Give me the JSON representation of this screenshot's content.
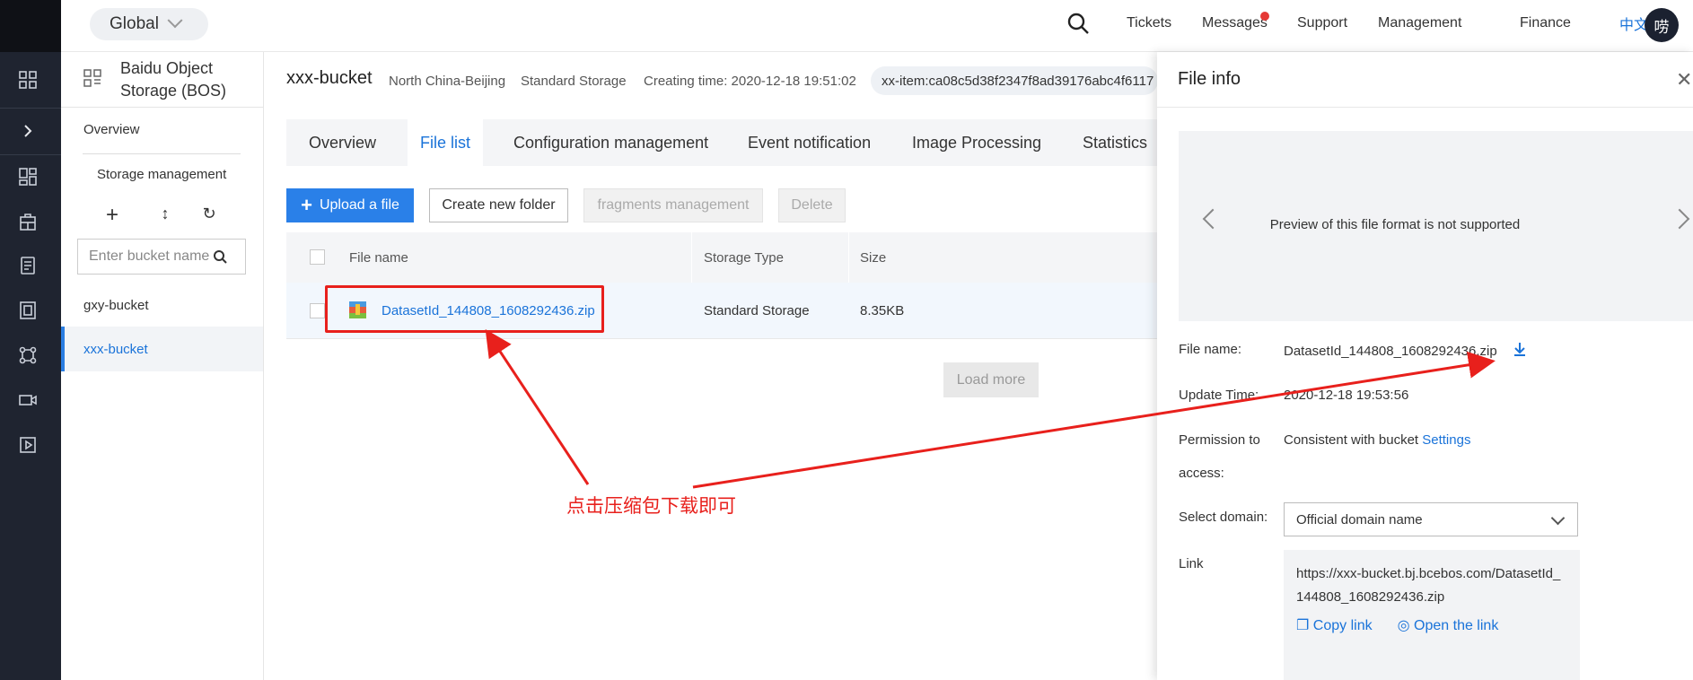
{
  "topbar": {
    "region": "Global",
    "nav": [
      "Tickets",
      "Messages",
      "Support",
      "Management",
      "Finance",
      "中文"
    ],
    "avatar": "唠"
  },
  "sidebar": {
    "service_title_line1": "Baidu Object",
    "service_title_line2": "Storage (BOS)",
    "overview": "Overview",
    "storage_management": "Storage management",
    "search_placeholder": "Enter bucket name",
    "buckets": [
      "gxy-bucket",
      "xxx-bucket"
    ],
    "active_bucket": "xxx-bucket"
  },
  "main": {
    "bucket_name": "xxx-bucket",
    "region": "North China-Beijing",
    "storage_class": "Standard Storage",
    "creating_time": "Creating time: 2020-12-18 19:51:02",
    "item_id": "xx-item:ca08c5d38f2347f8ad39176abc4f6117",
    "tabs": [
      "Overview",
      "File list",
      "Configuration management",
      "Event notification",
      "Image Processing",
      "Statistics"
    ],
    "active_tab": "File list",
    "buttons": {
      "upload": "Upload a file",
      "new_folder": "Create new folder",
      "fragments": "fragments management",
      "delete": "Delete"
    },
    "table": {
      "headers": [
        "File name",
        "Storage Type",
        "Size"
      ],
      "rows": [
        {
          "file_name": "DatasetId_144808_1608292436.zip",
          "storage_type": "Standard Storage",
          "size": "8.35KB"
        }
      ]
    },
    "load_more": "Load more",
    "annotation": "点击压缩包下载即可"
  },
  "drawer": {
    "title": "File info",
    "preview_text": "Preview of this file format is not supported",
    "file_name_label": "File name:",
    "file_name": "DatasetId_144808_1608292436.zip",
    "update_time_label": "Update Time:",
    "update_time": "2020-12-18 19:53:56",
    "permission_label_1": "Permission to",
    "permission_label_2": "access:",
    "permission_value": "Consistent with bucket",
    "settings_link": "Settings",
    "domain_label": "Select domain:",
    "domain_value": "Official domain name",
    "link_label": "Link",
    "link_line1": "https://xxx-bucket.bj.bcebos.com/DatasetId_",
    "link_line2": "144808_1608292436.zip",
    "copy_link": "Copy link",
    "open_link": "Open the link"
  },
  "colors": {
    "accent": "#2a80e8",
    "annotation_red": "#e8201c",
    "rail": "#1f2430"
  }
}
